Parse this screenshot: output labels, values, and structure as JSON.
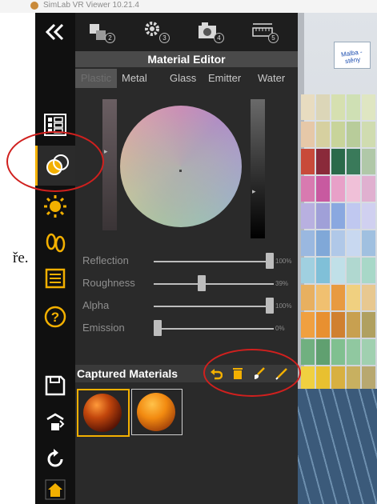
{
  "window": {
    "title": "SimLab VR Viewer 10.21.4"
  },
  "background_text": "ře.",
  "toolbar_vertical": [
    {
      "name": "collapse",
      "icon": "double-chevron-left-icon"
    },
    {
      "name": "objects",
      "icon": "tree-list-icon"
    },
    {
      "name": "materials",
      "icon": "material-spheres-icon",
      "selected": true
    },
    {
      "name": "lighting",
      "icon": "sun-icon"
    },
    {
      "name": "walk",
      "icon": "footprints-icon"
    },
    {
      "name": "notes",
      "icon": "notepad-icon"
    },
    {
      "name": "help",
      "icon": "help-circle-icon"
    },
    {
      "name": "save",
      "icon": "save-icon"
    },
    {
      "name": "export",
      "icon": "export-cube-icon"
    },
    {
      "name": "reset",
      "icon": "reset-icon"
    },
    {
      "name": "home",
      "icon": "home-icon"
    }
  ],
  "top_tabs": [
    {
      "icon": "cubes-icon",
      "badge": "2"
    },
    {
      "icon": "gears-icon",
      "badge": "3"
    },
    {
      "icon": "camera-icon",
      "badge": "4"
    },
    {
      "icon": "ruler-icon",
      "badge": "5"
    }
  ],
  "material_editor": {
    "title": "Material Editor",
    "tabs": [
      "Plastic",
      "Metal",
      "Glass",
      "Emitter",
      "Water"
    ],
    "active_tab": "Plastic",
    "sliders": [
      {
        "label": "Reflection",
        "value": "100%",
        "fraction": 1.0
      },
      {
        "label": "Roughness",
        "value": "39%",
        "fraction": 0.39
      },
      {
        "label": "Alpha",
        "value": "100%",
        "fraction": 1.0
      },
      {
        "label": "Emission",
        "value": "0%",
        "fraction": 0.0
      }
    ]
  },
  "captured_materials": {
    "title": "Captured Materials",
    "actions": [
      "undo-icon",
      "trash-icon",
      "brush-icon",
      "eyedropper-icon"
    ],
    "thumbnails": [
      {
        "name": "dark-orange-sphere",
        "selected": true
      },
      {
        "name": "orange-sphere",
        "selected": false
      }
    ]
  },
  "scene": {
    "sign_text": "Malba - stěny"
  },
  "colors": {
    "accent": "#f3b000",
    "annotation": "#d0201e"
  }
}
